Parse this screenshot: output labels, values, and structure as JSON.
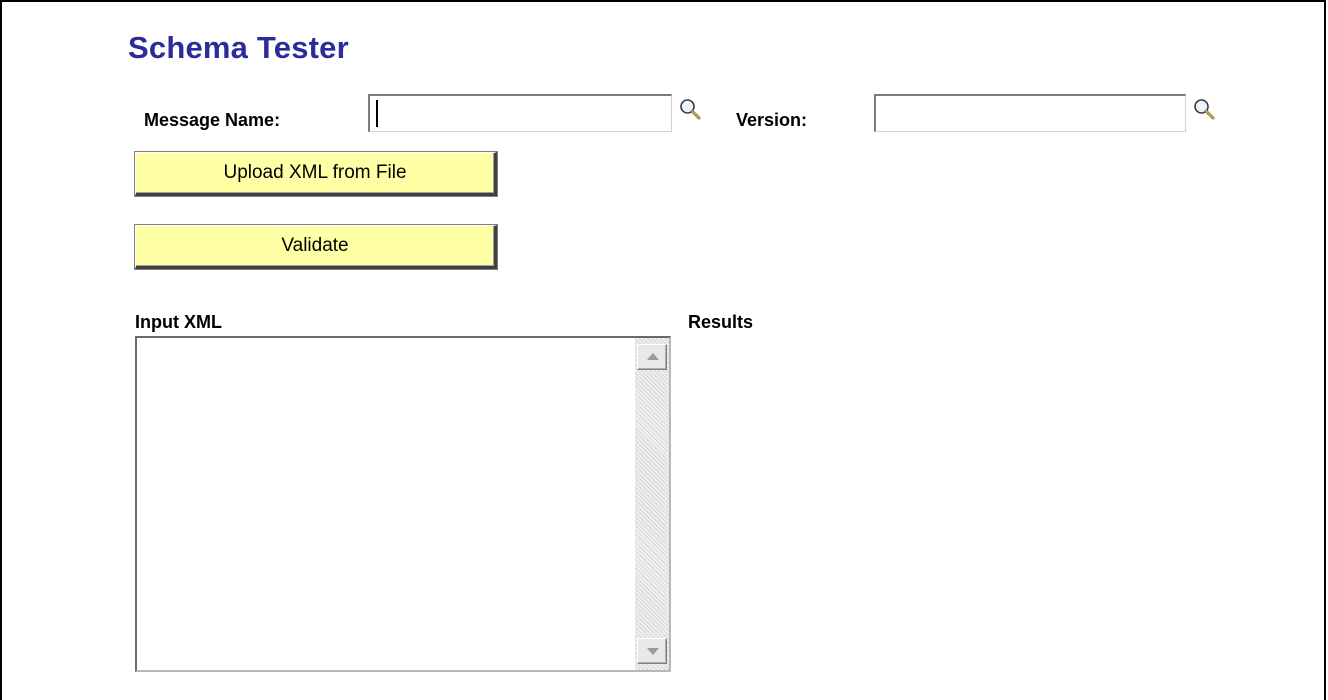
{
  "page": {
    "title": "Schema Tester",
    "title_color": "#2b2c99"
  },
  "form": {
    "message_name_label": "Message Name:",
    "message_name_value": "",
    "version_label": "Version:",
    "version_value": ""
  },
  "buttons": {
    "upload_label": "Upload XML from File",
    "validate_label": "Validate",
    "button_color": "#ffffa5"
  },
  "sections": {
    "input_xml_label": "Input XML",
    "input_xml_value": "",
    "results_label": "Results",
    "results_value": ""
  },
  "icons": {
    "message_name_lookup": "magnifier-icon",
    "version_lookup": "magnifier-icon",
    "scroll_up": "arrow-up-icon",
    "scroll_down": "arrow-down-icon"
  }
}
